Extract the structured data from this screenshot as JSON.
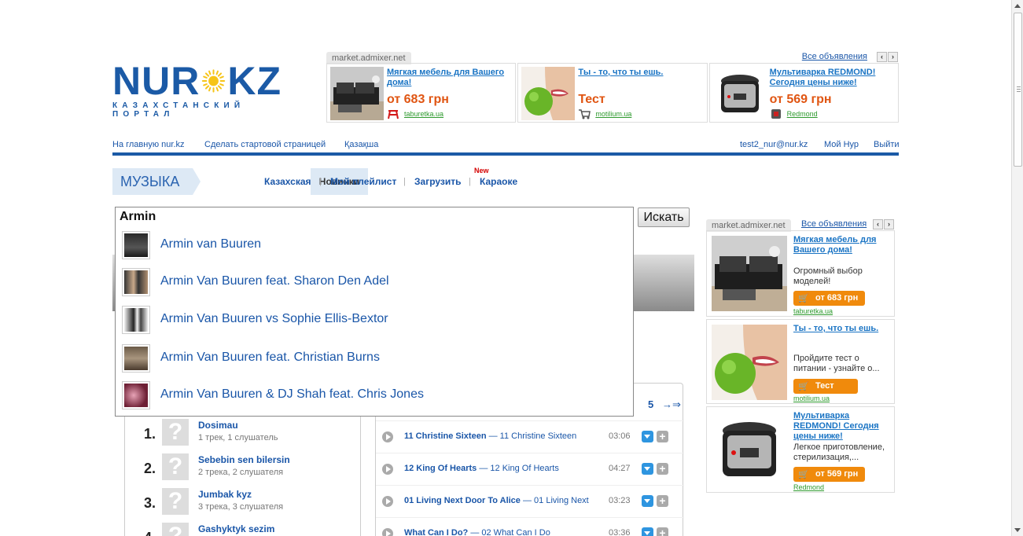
{
  "logo": {
    "left": "NUR",
    "right": "KZ",
    "tagline": "КАЗАХСТАНСКИЙ ПОРТАЛ"
  },
  "top_ads": {
    "source": "market.admixer.net",
    "all_label": "Все объявления",
    "prev": "‹",
    "next": "›",
    "cards": [
      {
        "title": "Мягкая мебель для Вашего дома!",
        "price": "от 683 грн",
        "site": "taburetka.ua"
      },
      {
        "title": "Ты - то, что ты ешь.",
        "price": "Тест",
        "site": "motilium.ua"
      },
      {
        "title": "Мультиварка REDMOND! Сегодня цены ниже!",
        "price": "от 569 грн",
        "site": "Redmond"
      }
    ]
  },
  "top_nav": {
    "home": "На главную nur.kz",
    "start_page": "Сделать стартовой страницей",
    "kazakh": "Қазақша",
    "email": "test2_nur@nur.kz",
    "my_nur": "Мой Нур",
    "logout": "Выйти"
  },
  "music_nav": {
    "section": "МУЗЫКА",
    "items": [
      "Новинки",
      "Казахская",
      "Мой плейлист",
      "Загрузить",
      "Караоке"
    ],
    "separator": "|",
    "new_badge": "New"
  },
  "search": {
    "query": "Armin",
    "button": "Искать",
    "suggestions": [
      "Armin van Buuren",
      "Armin Van Buuren feat. Sharon Den Adel",
      "Armin Van Buuren vs Sophie Ellis-Bextor",
      "Armin Van Buuren feat. Christian Burns",
      "Armin Van Buuren & DJ Shah feat. Chris Jones"
    ]
  },
  "artists": [
    {
      "rank": "1.",
      "name": "Dosimau",
      "meta": "1 трек, 1 слушатель"
    },
    {
      "rank": "2.",
      "name": "Sebebin sen bilersin",
      "meta": "2 трека, 2 слушателя"
    },
    {
      "rank": "3.",
      "name": "Jumbak kyz",
      "meta": "3 трека, 3 слушателя"
    },
    {
      "rank": "4.",
      "name": "Gashyktyk sezim",
      "meta": ""
    }
  ],
  "placeholder_glyph": "?",
  "tracks": {
    "page": "5",
    "next": "→⇒",
    "rows": [
      {
        "title": "11 Christine Sixteen",
        "album": " — 11 Christine Sixteen",
        "duration": "03:06"
      },
      {
        "title": "12 King Of Hearts",
        "album": " — 12 King Of Hearts",
        "duration": "04:27"
      },
      {
        "title": "01 Living Next Door To Alice",
        "album": " — 01 Living Next",
        "duration": "03:23"
      },
      {
        "title": "What Can I Do?",
        "album": " — 02 What Can I Do",
        "duration": "03:36"
      }
    ],
    "add_glyph": "+"
  },
  "side_ads": {
    "source": "market.admixer.net",
    "all_label": "Все объявления",
    "prev": "‹",
    "next": "›",
    "cards": [
      {
        "title": "Мягкая мебель для Вашего дома!",
        "desc": "Огромный выбор моделей!",
        "button": "от 683 грн",
        "site": "taburetka.ua"
      },
      {
        "title": "Ты - то, что ты ешь.",
        "desc": "Пройдите тест о питании - узнайте о...",
        "button": "Тест",
        "site": "motilium.ua"
      },
      {
        "title": "Мультиварка REDMOND! Сегодня цены ниже!",
        "desc": "Легкое приготовление, стерилизация,...",
        "button": "от 569 грн",
        "site": "Redmond"
      }
    ]
  },
  "colors": {
    "brand_blue": "#1b5aa6",
    "link_blue": "#1a56a8",
    "price_orange": "#e05512",
    "button_orange": "#f08a0c",
    "site_green": "#2e9a2e"
  }
}
